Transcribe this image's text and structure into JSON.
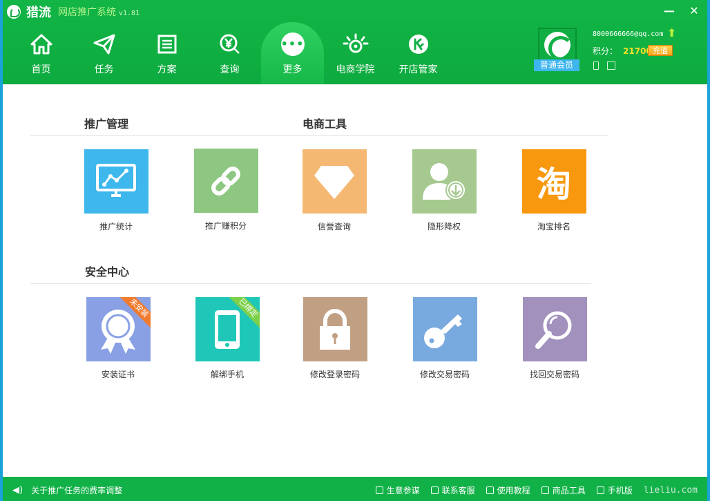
{
  "app": {
    "brand": "猎流",
    "subtitle": "网店推广系统",
    "version": "v1.81",
    "minimize": "—",
    "close": "✕"
  },
  "nav": [
    {
      "label": "首页",
      "icon": "home-icon"
    },
    {
      "label": "任务",
      "icon": "send-icon"
    },
    {
      "label": "方案",
      "icon": "list-icon"
    },
    {
      "label": "查询",
      "icon": "yen-search-icon"
    },
    {
      "label": "更多",
      "icon": "more-icon",
      "active": true
    },
    {
      "label": "电商学院",
      "icon": "academy-icon"
    },
    {
      "label": "开店管家",
      "icon": "shop-manager-icon"
    }
  ],
  "user": {
    "email": "8000666666@qq.com",
    "points_label": "积分：",
    "points": "21700",
    "recharge": "充值",
    "member_level": "普通会员"
  },
  "sections": {
    "promo_title": "推广管理",
    "ecom_title": "电商工具",
    "security_title": "安全中心"
  },
  "tools": [
    {
      "label": "推广统计",
      "color": "#3db7ec",
      "icon": "monitor-chart-icon"
    },
    {
      "label": "推广赚积分",
      "color": "#8ec782",
      "icon": "link-icon"
    },
    {
      "label": "信誉查询",
      "color": "#f4b873",
      "icon": "diamond-icon"
    },
    {
      "label": "隐形降权",
      "color": "#a6c98f",
      "icon": "user-download-icon"
    },
    {
      "label": "淘宝排名",
      "color": "#f7980f",
      "icon": "taobao-icon",
      "glyph": "淘"
    }
  ],
  "security": [
    {
      "label": "安装证书",
      "color": "#8aa0e4",
      "icon": "certificate-icon",
      "ribbon": "未安装",
      "ribbon_color": "#f17b2d"
    },
    {
      "label": "解绑手机",
      "color": "#1ec7b7",
      "icon": "phone-icon",
      "ribbon": "已绑定",
      "ribbon_color": "#7dd04a"
    },
    {
      "label": "修改登录密码",
      "color": "#c19f83",
      "icon": "lock-icon"
    },
    {
      "label": "修改交易密码",
      "color": "#78aadf",
      "icon": "key-icon"
    },
    {
      "label": "找回交易密码",
      "color": "#a291bd",
      "icon": "magnifier-icon"
    }
  ],
  "status": {
    "notice": "关于推广任务的费率调整",
    "links": [
      "生意参谋",
      "联系客服",
      "使用教程",
      "商品工具",
      "手机版"
    ],
    "site": "lieliu.com"
  }
}
